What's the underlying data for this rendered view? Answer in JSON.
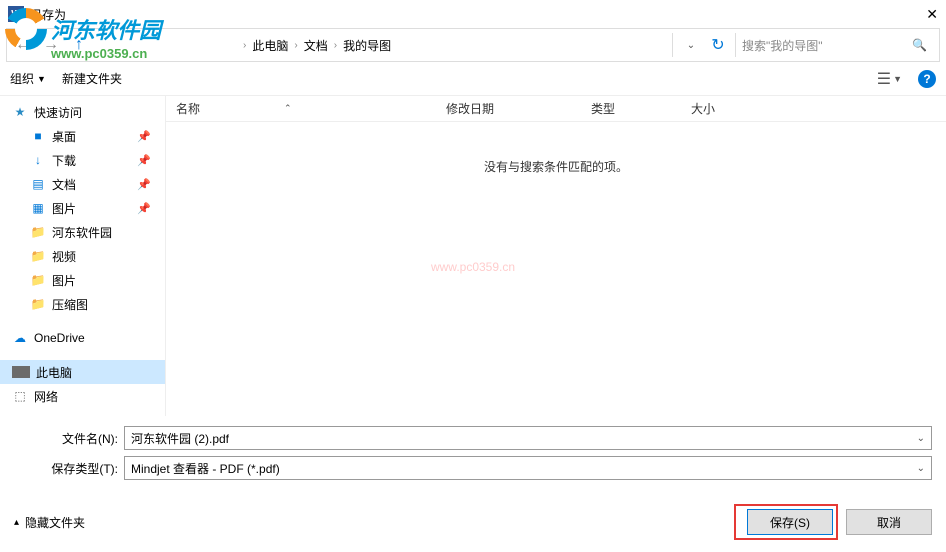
{
  "window": {
    "title": "另存为",
    "close": "✕"
  },
  "watermark": {
    "text": "河东软件园",
    "url": "www.pc0359.cn",
    "center": "www.pc0359.cn"
  },
  "nav": {
    "back": "←",
    "fwd": "→",
    "up": "↑",
    "crumbs": [
      "此电脑",
      "文档",
      "我的导图"
    ],
    "refresh": "↻",
    "search_placeholder": "搜索\"我的导图\""
  },
  "toolbar": {
    "organize": "组织",
    "newfolder": "新建文件夹",
    "view_icon": "☰",
    "help": "?"
  },
  "columns": {
    "name": "名称",
    "date": "修改日期",
    "type": "类型",
    "size": "大小"
  },
  "sidebar": [
    {
      "icon": "★",
      "cls": "i-star",
      "label": "快速访问",
      "pin": false,
      "child": false
    },
    {
      "icon": "■",
      "cls": "i-desktop",
      "label": "桌面",
      "pin": true,
      "child": true
    },
    {
      "icon": "↓",
      "cls": "i-dl",
      "label": "下载",
      "pin": true,
      "child": true
    },
    {
      "icon": "▤",
      "cls": "i-doc",
      "label": "文档",
      "pin": true,
      "child": true
    },
    {
      "icon": "▦",
      "cls": "i-pic",
      "label": "图片",
      "pin": true,
      "child": true
    },
    {
      "icon": "📁",
      "cls": "i-folder",
      "label": "河东软件园",
      "pin": false,
      "child": true
    },
    {
      "icon": "📁",
      "cls": "i-folder",
      "label": "视频",
      "pin": false,
      "child": true
    },
    {
      "icon": "📁",
      "cls": "i-folder",
      "label": "图片",
      "pin": false,
      "child": true
    },
    {
      "icon": "📁",
      "cls": "i-folder",
      "label": "压缩图",
      "pin": false,
      "child": true
    },
    {
      "icon": "☁",
      "cls": "i-cloud",
      "label": "OneDrive",
      "pin": false,
      "child": false
    },
    {
      "icon": "",
      "cls": "i-pc",
      "label": "此电脑",
      "pin": false,
      "child": false,
      "sel": true
    },
    {
      "icon": "⬚",
      "cls": "i-net",
      "label": "网络",
      "pin": false,
      "child": false
    }
  ],
  "empty_text": "没有与搜索条件匹配的项。",
  "fields": {
    "filename_label": "文件名(N):",
    "filename_value": "河东软件园 (2).pdf",
    "filetype_label": "保存类型(T):",
    "filetype_value": "Mindjet 查看器 - PDF (*.pdf)"
  },
  "footer": {
    "hide_folders": "隐藏文件夹",
    "save": "保存(S)",
    "cancel": "取消"
  }
}
